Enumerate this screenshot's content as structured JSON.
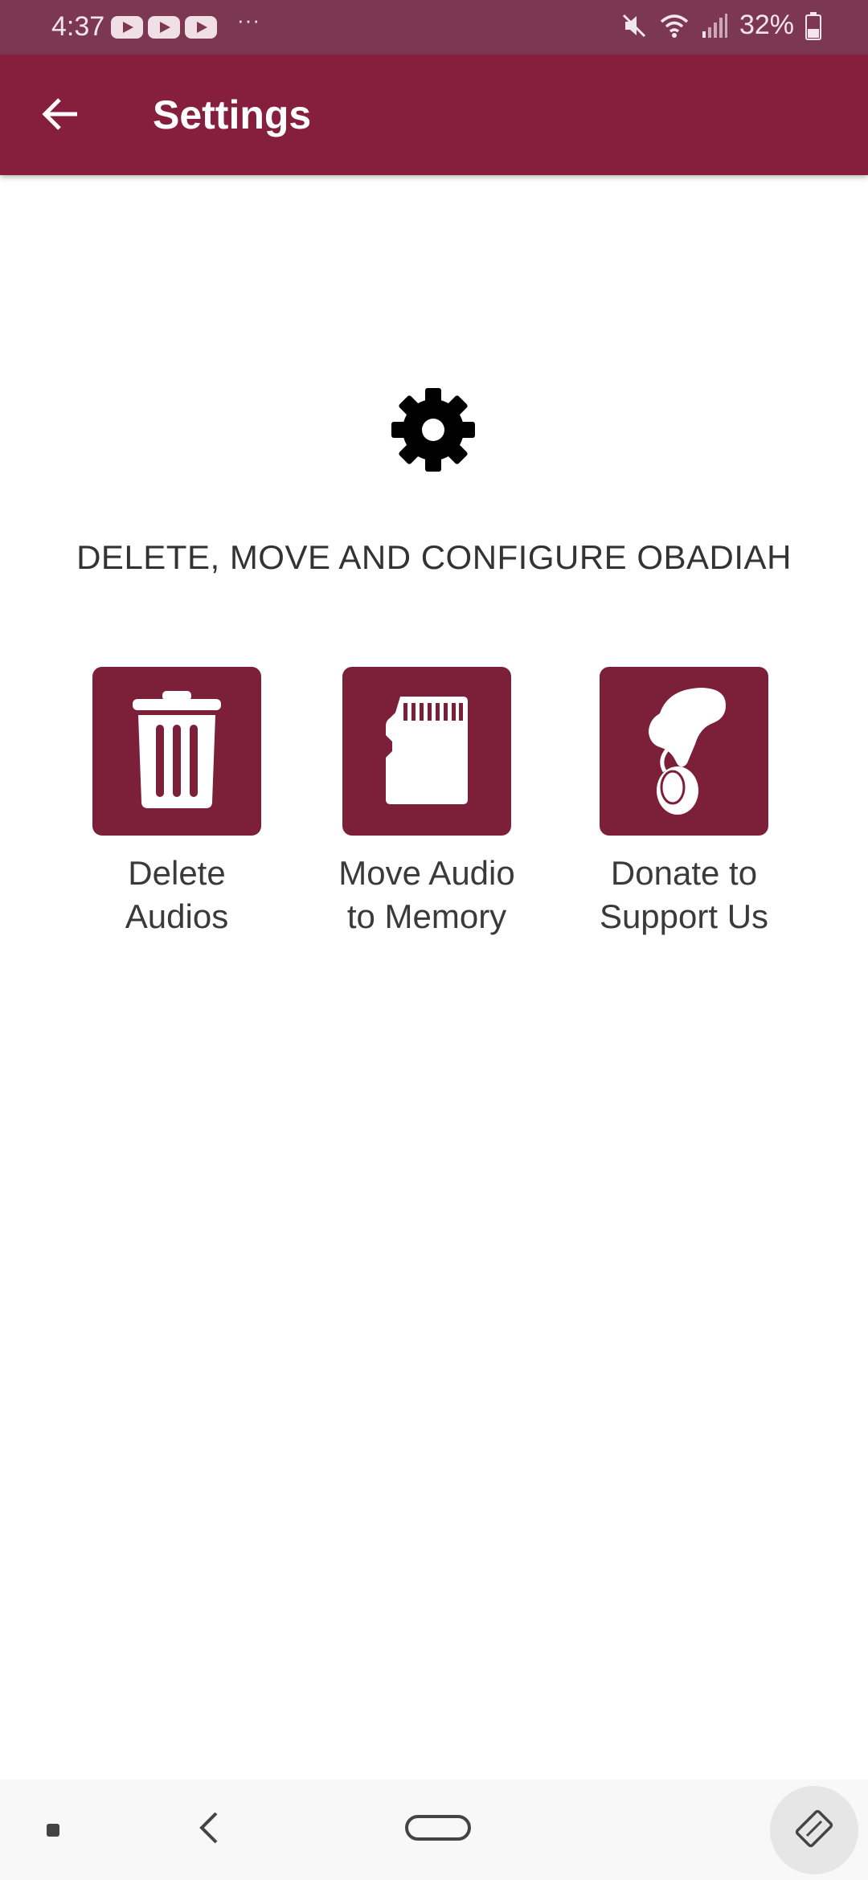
{
  "status_bar": {
    "time": "4:37",
    "more": "···",
    "battery": "32%",
    "icons": [
      "youtube-icon",
      "youtube-icon",
      "youtube-icon",
      "mute-icon",
      "wifi-icon",
      "signal-icon",
      "battery-icon"
    ]
  },
  "app_bar": {
    "title": "Settings",
    "back_icon": "arrow-left-icon",
    "background": "#861f3d"
  },
  "content": {
    "header_icon": "gear-icon",
    "heading": "DELETE, MOVE AND CONFIGURE OBADIAH",
    "options": [
      {
        "label": "Delete\nAudios",
        "icon": "trash-icon"
      },
      {
        "label": "Move Audio\nto Memory",
        "icon": "sd-card-icon"
      },
      {
        "label": "Donate to\nSupport Us",
        "icon": "donate-hand-icon"
      }
    ],
    "tile_color": "#7c1f39"
  },
  "nav_bar": {
    "icons": [
      "recents-icon",
      "back-icon",
      "home-icon",
      "rotate-icon"
    ]
  }
}
